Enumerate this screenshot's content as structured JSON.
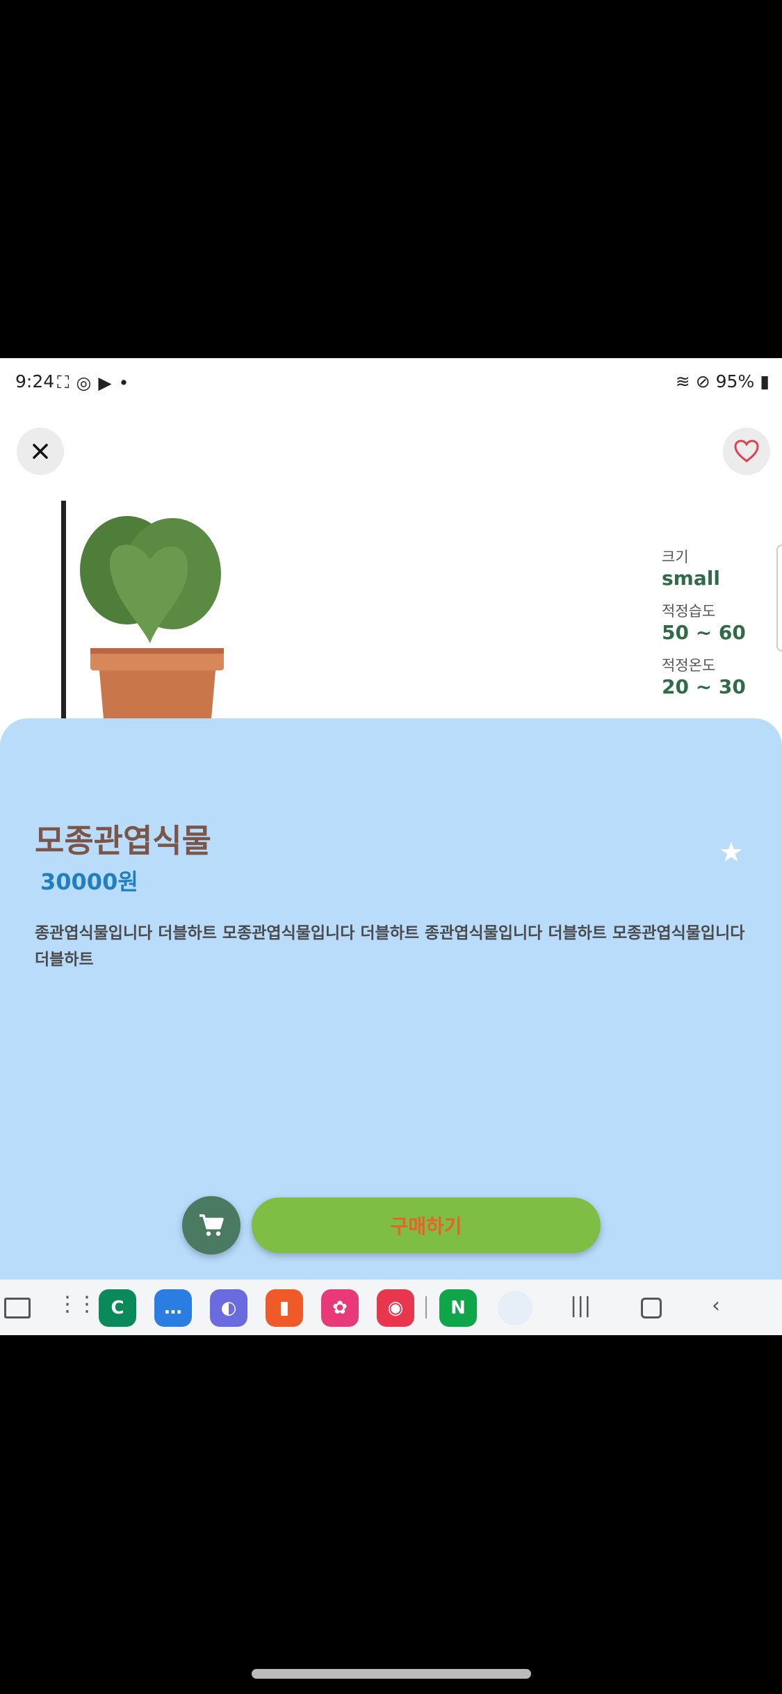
{
  "status_bar": {
    "time": "9:24",
    "battery": "95%"
  },
  "product": {
    "name": "모종관엽식물",
    "price": "30000원",
    "description": "종관엽식물입니다 더블하트 모종관엽식물입니다 더블하트 종관엽식물입니다 더블하트 모종관엽식물입니다 더블하트"
  },
  "specs": [
    {
      "label": "크기",
      "value": "small"
    },
    {
      "label": "적정습도",
      "value": "50 ~ 60"
    },
    {
      "label": "적정온도",
      "value": "20 ~ 30"
    }
  ],
  "actions": {
    "buy_label": "구매하기"
  },
  "icons": {
    "close": "close-icon",
    "favorite": "heart-icon",
    "star": "star-icon",
    "cart": "cart-icon"
  },
  "colors": {
    "sheet": "#b9dcfb",
    "title": "#7a5548",
    "price": "#1f7fbf",
    "spec_value": "#2f6b47",
    "buy_button": "#7ebe45",
    "buy_text": "#e8622a",
    "cart_button": "#4a7a62",
    "heart": "#e04050"
  },
  "taskbar_apps": [
    {
      "name": "phone",
      "color": "#0a8a5a",
      "glyph": "C"
    },
    {
      "name": "messages",
      "color": "#2a7de1",
      "glyph": "…"
    },
    {
      "name": "internet",
      "color": "#6b6be0",
      "glyph": "◐"
    },
    {
      "name": "notes",
      "color": "#f05a28",
      "glyph": "▮"
    },
    {
      "name": "gallery",
      "color": "#e83a78",
      "glyph": "✿"
    },
    {
      "name": "camera",
      "color": "#e8364e",
      "glyph": "◉"
    },
    {
      "name": "naver",
      "color": "#0fa64a",
      "glyph": "N"
    }
  ]
}
